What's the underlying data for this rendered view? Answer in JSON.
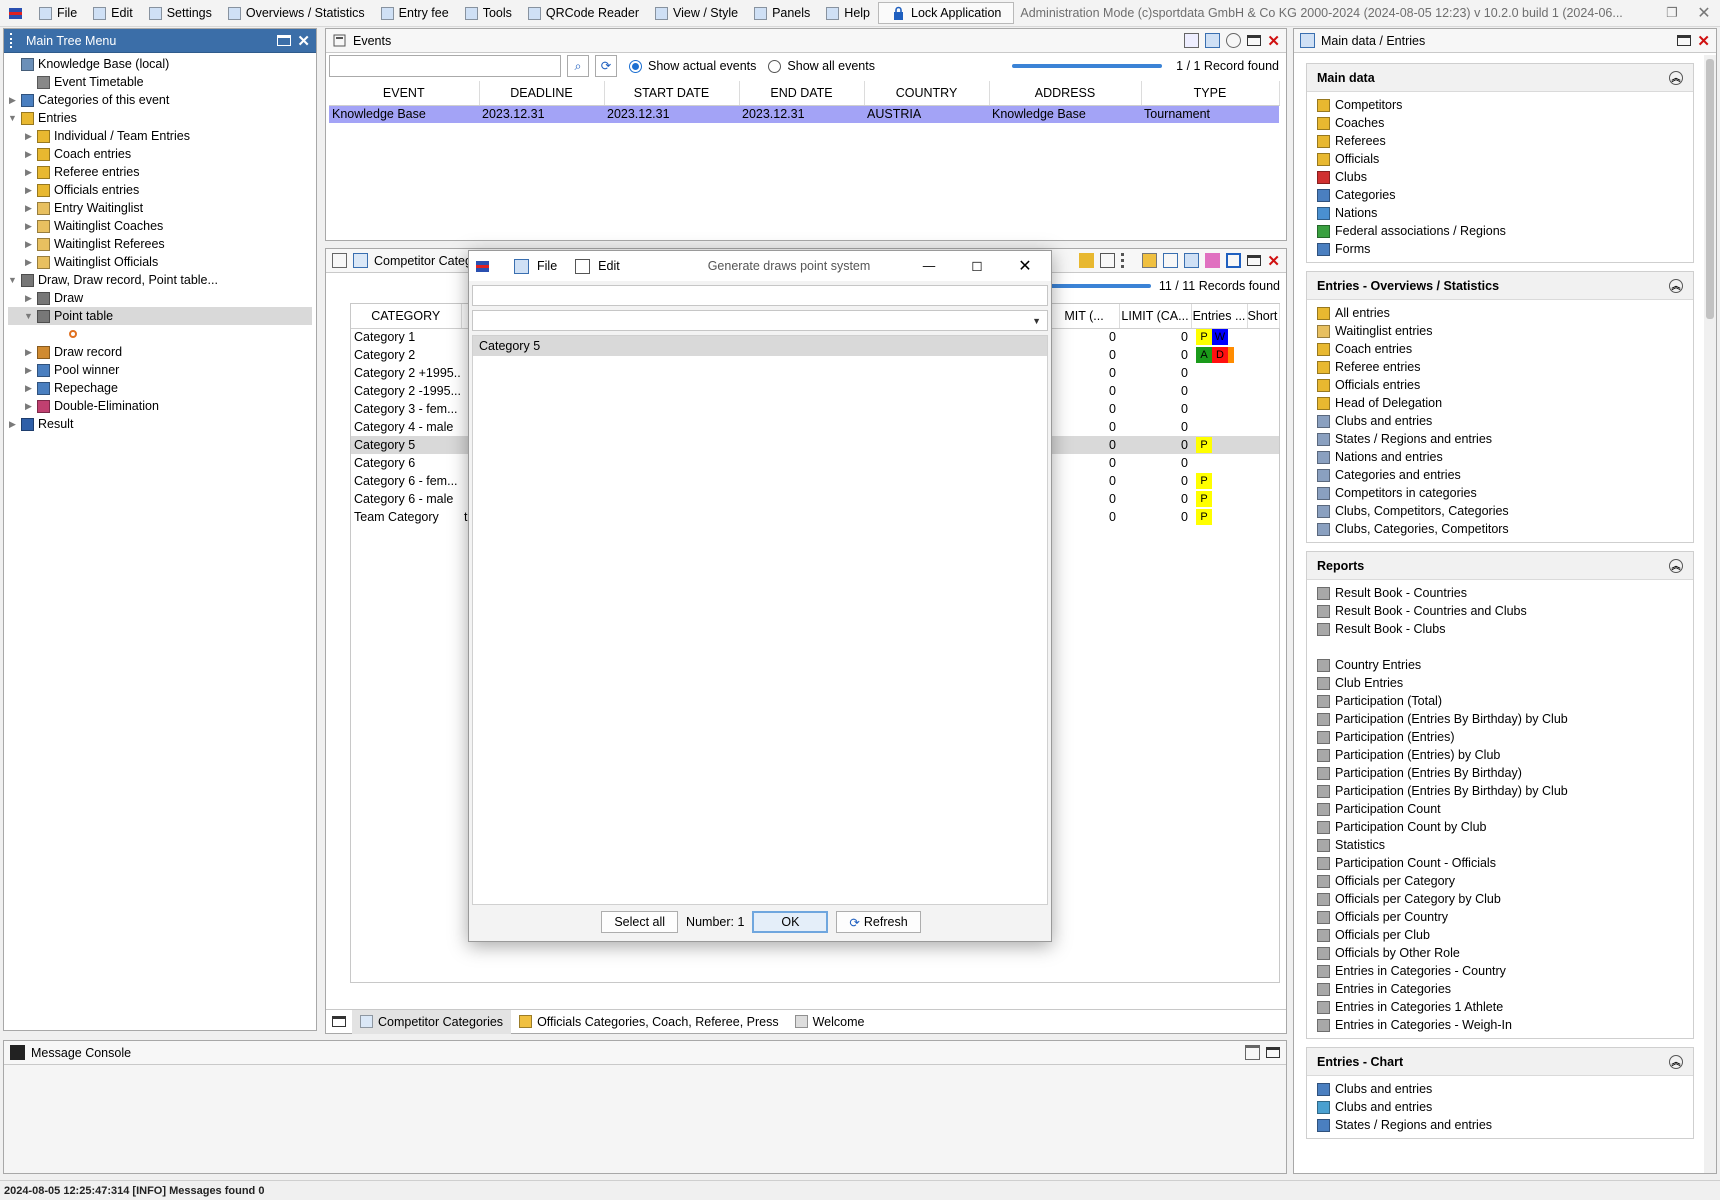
{
  "menubar": {
    "items": [
      "File",
      "Edit",
      "Settings",
      "Overviews / Statistics",
      "Entry fee",
      "Tools",
      "QRCode Reader",
      "View / Style",
      "Panels",
      "Help"
    ],
    "lock": "Lock Application",
    "title": "Administration Mode (c)sportdata GmbH & Co KG 2000-2024 (2024-08-05 12:23)  v 10.2.0 build 1 (2024-06..."
  },
  "tree": {
    "title": "Main Tree Menu",
    "items": [
      {
        "label": "Knowledge Base (local)",
        "level": 0,
        "tri": "",
        "icon": "#6b8fb8"
      },
      {
        "label": "Event Timetable",
        "level": 1,
        "tri": "",
        "icon": "#888"
      },
      {
        "label": "Categories of this event",
        "level": 0,
        "tri": "▶",
        "icon": "#4a7fc0"
      },
      {
        "label": "Entries",
        "level": 0,
        "tri": "▼",
        "icon": "#e8b830"
      },
      {
        "label": "Individual / Team Entries",
        "level": 1,
        "tri": "▶",
        "icon": "#e8b830"
      },
      {
        "label": "Coach entries",
        "level": 1,
        "tri": "▶",
        "icon": "#e8b830"
      },
      {
        "label": "Referee entries",
        "level": 1,
        "tri": "▶",
        "icon": "#e8b830"
      },
      {
        "label": "Officials entries",
        "level": 1,
        "tri": "▶",
        "icon": "#e8b830"
      },
      {
        "label": "Entry Waitinglist",
        "level": 1,
        "tri": "▶",
        "icon": "#e8c060"
      },
      {
        "label": "Waitinglist Coaches",
        "level": 1,
        "tri": "▶",
        "icon": "#e8c060"
      },
      {
        "label": "Waitinglist Referees",
        "level": 1,
        "tri": "▶",
        "icon": "#e8c060"
      },
      {
        "label": "Waitinglist Officials",
        "level": 1,
        "tri": "▶",
        "icon": "#e8c060"
      },
      {
        "label": "Draw, Draw record, Point table...",
        "level": 0,
        "tri": "▼",
        "icon": "#777"
      },
      {
        "label": "Draw",
        "level": 1,
        "tri": "▶",
        "icon": "#777"
      },
      {
        "label": "Point table",
        "level": 1,
        "tri": "▼",
        "icon": "#777",
        "selected": true
      },
      {
        "label": "",
        "level": 2,
        "tri": "",
        "icon": "#e07020",
        "dot": true
      },
      {
        "label": "Draw record",
        "level": 1,
        "tri": "▶",
        "icon": "#d08a30"
      },
      {
        "label": "Pool winner",
        "level": 1,
        "tri": "▶",
        "icon": "#4a7fc0"
      },
      {
        "label": "Repechage",
        "level": 1,
        "tri": "▶",
        "icon": "#4a7fc0"
      },
      {
        "label": "Double-Elimination",
        "level": 1,
        "tri": "▶",
        "icon": "#c04070"
      },
      {
        "label": "Result",
        "level": 0,
        "tri": "▶",
        "icon": "#2f5fa8"
      }
    ]
  },
  "events": {
    "title": "Events",
    "search_value": "",
    "radio_actual": "Show actual events",
    "radio_all": "Show all events",
    "records": "1 / 1 Record found",
    "columns": [
      "EVENT",
      "DEADLINE",
      "START DATE",
      "END DATE",
      "COUNTRY",
      "ADDRESS",
      "TYPE"
    ],
    "rows": [
      [
        "Knowledge Base",
        "2023.12.31",
        "2023.12.31",
        "2023.12.31",
        "AUSTRIA",
        "Knowledge Base",
        "Tournament"
      ]
    ]
  },
  "categories": {
    "title": "Competitor Categ",
    "records": "11 / 11 Records found",
    "columns": [
      "CATEGORY",
      "MIT (...",
      "LIMIT (CA...",
      "Entries ...",
      "Short ..."
    ],
    "rows": [
      {
        "name": "Category 1",
        "a": "0",
        "b": "0",
        "badges": [
          {
            "t": "P",
            "c": "#ffff00"
          },
          {
            "t": "W",
            "c": "#0000ff"
          }
        ]
      },
      {
        "name": "Category 2",
        "a": "0",
        "b": "0",
        "badges": [
          {
            "t": "A",
            "c": "#1a9a1a"
          },
          {
            "t": "D",
            "c": "#ff1010"
          },
          {
            "t": "",
            "c": "#ff8c00"
          }
        ]
      },
      {
        "name": "Category 2 +1995...",
        "a": "0",
        "b": "0",
        "badges": []
      },
      {
        "name": "Category 2 -1995...",
        "a": "0",
        "b": "0",
        "badges": []
      },
      {
        "name": "Category 3 - fem...",
        "a": "0",
        "b": "0",
        "badges": []
      },
      {
        "name": "Category 4 - male",
        "a": "0",
        "b": "0",
        "badges": []
      },
      {
        "name": "Category 5",
        "a": "0",
        "b": "0",
        "badges": [
          {
            "t": "P",
            "c": "#ffff00"
          }
        ],
        "selected": true
      },
      {
        "name": "Category 6",
        "a": "0",
        "b": "0",
        "badges": []
      },
      {
        "name": "Category 6 - fem...",
        "a": "0",
        "b": "0",
        "badges": [
          {
            "t": "P",
            "c": "#ffff00"
          }
        ]
      },
      {
        "name": "Category 6 - male",
        "a": "0",
        "b": "0",
        "badges": [
          {
            "t": "P",
            "c": "#ffff00"
          }
        ]
      },
      {
        "name": "Team Category",
        "a": "0",
        "b": "0",
        "badges": [
          {
            "t": "P",
            "c": "#ffff00"
          }
        ],
        "trail": "t"
      }
    ]
  },
  "bottom_tabs": [
    "Competitor Categories",
    "Officials Categories, Coach, Referee, Press",
    "Welcome"
  ],
  "dialog": {
    "menu_file": "File",
    "menu_edit": "Edit",
    "title": "Generate draws point system",
    "filter_value": "",
    "combo_value": "",
    "list": [
      "Category 5"
    ],
    "btn_select_all": "Select all",
    "number_label": "Number: 1",
    "btn_ok": "OK",
    "btn_refresh": "Refresh"
  },
  "right_panel": {
    "title": "Main data / Entries",
    "sections": [
      {
        "title": "Main data",
        "items": [
          {
            "label": "Competitors",
            "icon": "#e8b830"
          },
          {
            "label": "Coaches",
            "icon": "#e8b830"
          },
          {
            "label": "Referees",
            "icon": "#e8b830"
          },
          {
            "label": "Officials",
            "icon": "#e8b830"
          },
          {
            "label": "Clubs",
            "icon": "#d03030"
          },
          {
            "label": "Categories",
            "icon": "#4a7fc0"
          },
          {
            "label": "Nations",
            "icon": "#4a90d0"
          },
          {
            "label": "Federal associations / Regions",
            "icon": "#3aa040"
          },
          {
            "label": "Forms",
            "icon": "#4a7fc0"
          }
        ]
      },
      {
        "title": "Entries - Overviews / Statistics",
        "items": [
          {
            "label": "All entries",
            "icon": "#e8b830"
          },
          {
            "label": "Waitinglist entries",
            "icon": "#e8c060"
          },
          {
            "label": "Coach entries",
            "icon": "#e8b830"
          },
          {
            "label": "Referee entries",
            "icon": "#e8b830"
          },
          {
            "label": "Officials entries",
            "icon": "#e8b830"
          },
          {
            "label": "Head of Delegation",
            "icon": "#e8b830"
          },
          {
            "label": "Clubs and entries",
            "icon": "#8aa0c0"
          },
          {
            "label": "States / Regions and entries",
            "icon": "#8aa0c0"
          },
          {
            "label": "Nations and entries",
            "icon": "#8aa0c0"
          },
          {
            "label": "Categories and entries",
            "icon": "#8aa0c0"
          },
          {
            "label": "Competitors in categories",
            "icon": "#8aa0c0"
          },
          {
            "label": "Clubs, Competitors, Categories",
            "icon": "#8aa0c0"
          },
          {
            "label": "Clubs, Categories, Competitors",
            "icon": "#8aa0c0"
          }
        ]
      },
      {
        "title": "Reports",
        "items": [
          {
            "label": "Result Book - Countries",
            "icon": "#a8a8a8"
          },
          {
            "label": "Result Book - Countries and Clubs",
            "icon": "#a8a8a8"
          },
          {
            "label": "Result Book - Clubs",
            "icon": "#a8a8a8"
          },
          {
            "label": "",
            "icon": ""
          },
          {
            "label": "Country Entries",
            "icon": "#a8a8a8"
          },
          {
            "label": "Club Entries",
            "icon": "#a8a8a8"
          },
          {
            "label": "Participation (Total)",
            "icon": "#a8a8a8"
          },
          {
            "label": "Participation (Entries By Birthday) by Club",
            "icon": "#a8a8a8"
          },
          {
            "label": "Participation (Entries)",
            "icon": "#a8a8a8"
          },
          {
            "label": "Participation (Entries) by Club",
            "icon": "#a8a8a8"
          },
          {
            "label": "Participation (Entries By Birthday)",
            "icon": "#a8a8a8"
          },
          {
            "label": "Participation (Entries By Birthday) by Club",
            "icon": "#a8a8a8"
          },
          {
            "label": "Participation Count",
            "icon": "#a8a8a8"
          },
          {
            "label": "Participation Count by Club",
            "icon": "#a8a8a8"
          },
          {
            "label": "Statistics",
            "icon": "#a8a8a8"
          },
          {
            "label": "Participation Count - Officials",
            "icon": "#a8a8a8"
          },
          {
            "label": "Officials per Category",
            "icon": "#a8a8a8"
          },
          {
            "label": "Officials per Category by Club",
            "icon": "#a8a8a8"
          },
          {
            "label": "Officials per Country",
            "icon": "#a8a8a8"
          },
          {
            "label": "Officials per Club",
            "icon": "#a8a8a8"
          },
          {
            "label": "Officials by Other Role",
            "icon": "#a8a8a8"
          },
          {
            "label": "Entries in Categories - Country",
            "icon": "#a8a8a8"
          },
          {
            "label": "Entries in Categories",
            "icon": "#a8a8a8"
          },
          {
            "label": "Entries in Categories 1 Athlete",
            "icon": "#a8a8a8"
          },
          {
            "label": "Entries in Categories - Weigh-In",
            "icon": "#a8a8a8"
          }
        ]
      },
      {
        "title": "Entries - Chart",
        "items": [
          {
            "label": "Clubs and entries",
            "icon": "#4a7fc0"
          },
          {
            "label": "Clubs and entries",
            "icon": "#4aa0d0"
          },
          {
            "label": "States / Regions and entries",
            "icon": "#4a7fc0"
          }
        ]
      }
    ]
  },
  "console": {
    "title": "Message Console",
    "status": "2024-08-05 12:25:47:314 [INFO] Messages found 0"
  },
  "colors": {
    "accent": "#3b6ea8",
    "selection": "#a3a3f6",
    "close": "#d01010"
  }
}
